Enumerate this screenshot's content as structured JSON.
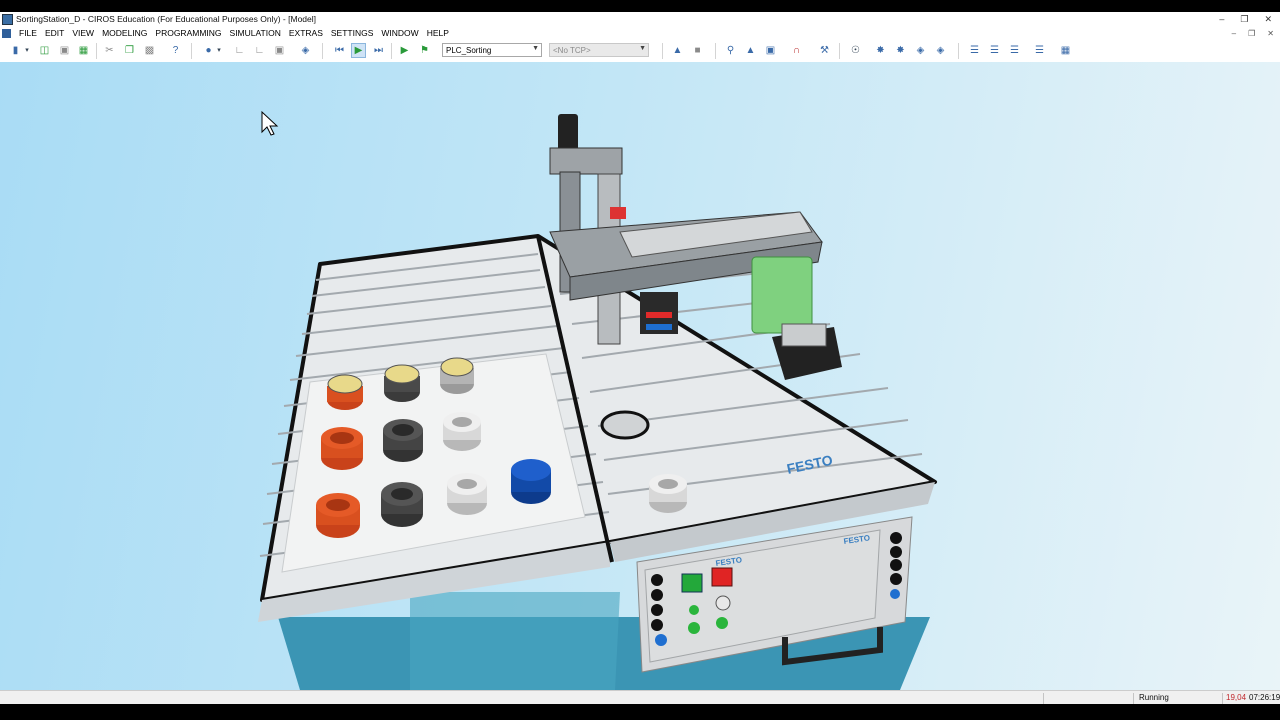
{
  "window": {
    "title": "SortingStation_D - CIROS Education (For Educational Purposes Only) - [Model]"
  },
  "menu": [
    "FILE",
    "EDIT",
    "VIEW",
    "MODELING",
    "PROGRAMMING",
    "SIMULATION",
    "EXTRAS",
    "SETTINGS",
    "WINDOW",
    "HELP"
  ],
  "toolbar": {
    "program_select": "PLC_Sorting",
    "tcp_select": "<No TCP>"
  },
  "scene": {
    "logo_table": "FESTO",
    "logo_panel_1": "FESTO",
    "logo_panel_2": "FESTO"
  },
  "status": {
    "state": "Running",
    "value": "19,04",
    "time": "07:26:19"
  },
  "colors": {
    "accent": "#3a6aa8",
    "running_value": "#c0282d",
    "viewport_bg": "#b9e2f6"
  }
}
